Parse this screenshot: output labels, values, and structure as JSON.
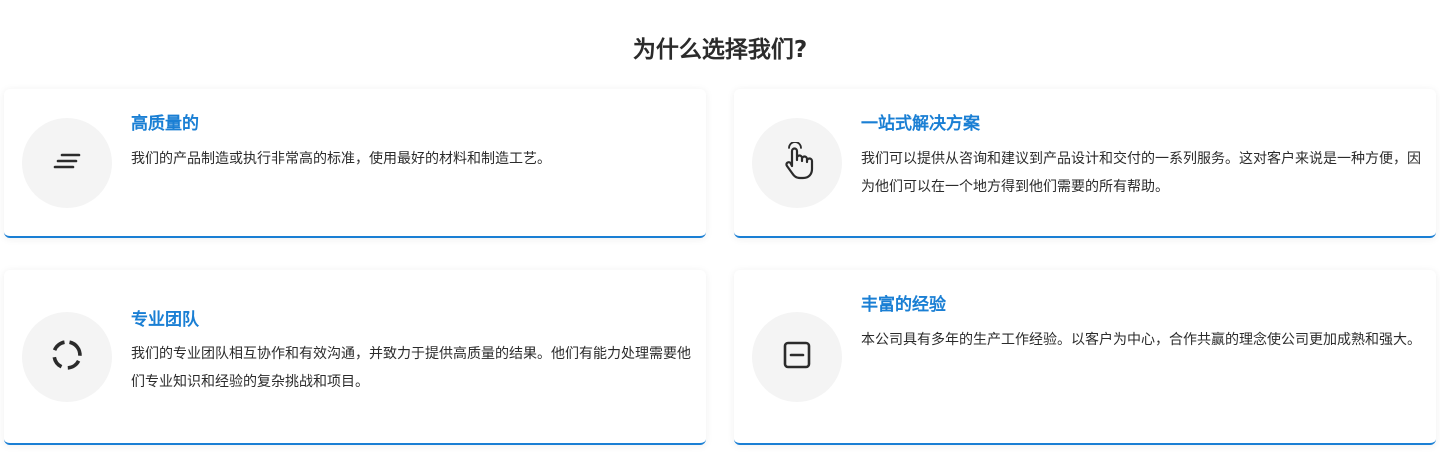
{
  "section": {
    "title": "为什么选择我们?"
  },
  "cards": [
    {
      "title": "高质量的",
      "description": "我们的产品制造或执行非常高的标准，使用最好的材料和制造工艺。",
      "icon": "short-text-icon"
    },
    {
      "title": "一站式解决方案",
      "description": "我们可以提供从咨询和建议到产品设计和交付的一系列服务。这对客户来说是一种方便，因为他们可以在一个地方得到他们需要的所有帮助。",
      "icon": "touch-hand-icon"
    },
    {
      "title": "专业团队",
      "description": "我们的专业团队相互协作和有效沟通，并致力于提供高质量的结果。他们有能力处理需要他们专业知识和经验的复杂挑战和项目。",
      "icon": "circle-segments-icon"
    },
    {
      "title": "丰富的经验",
      "description": "本公司具有多年的生产工作经验。以客户为中心，合作共赢的理念使公司更加成熟和强大。",
      "icon": "minus-box-icon"
    }
  ],
  "colors": {
    "accent": "#1a7fd4",
    "text": "#2b2b2b",
    "icon_bg": "#f4f4f4"
  }
}
